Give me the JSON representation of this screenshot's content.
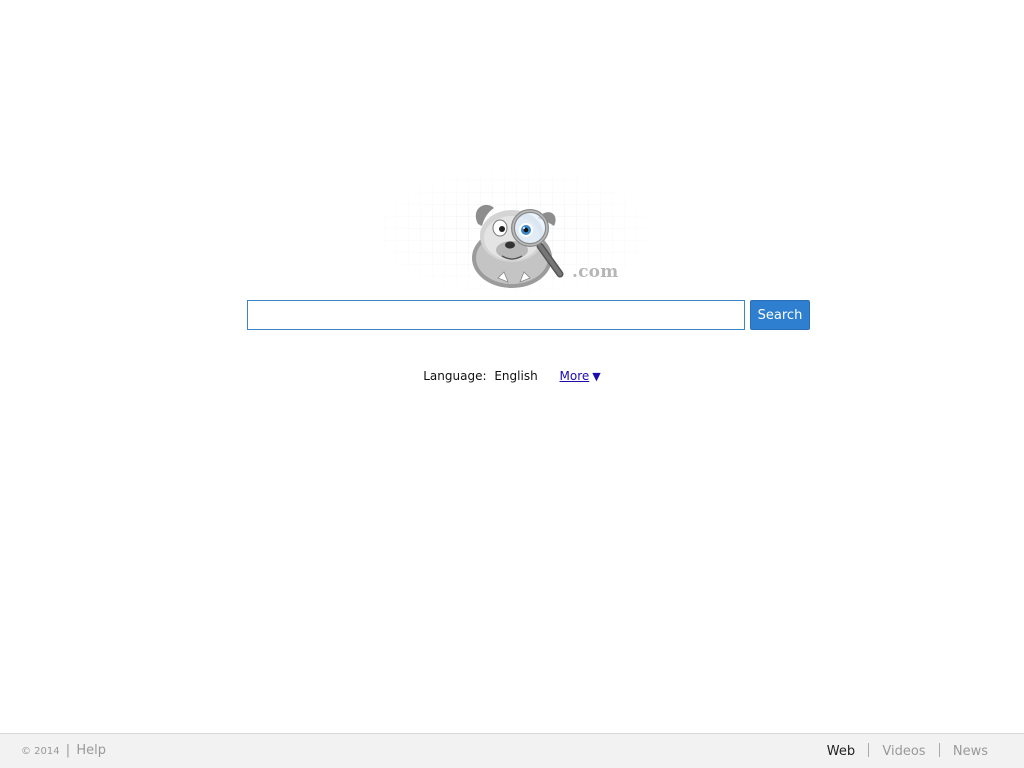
{
  "logo": {
    "suffix": ".com",
    "icon": "bulldog-magnifier-icon"
  },
  "search": {
    "value": "",
    "placeholder": "",
    "button_label": "Search"
  },
  "language": {
    "label": "Language:",
    "value": "English",
    "more_label": "More",
    "more_arrow": "▼"
  },
  "footer": {
    "copyright": "© 2014",
    "separator": "|",
    "help_label": "Help",
    "nav": [
      {
        "label": "Web",
        "active": true
      },
      {
        "label": "Videos",
        "active": false
      },
      {
        "label": "News",
        "active": false
      }
    ]
  },
  "colors": {
    "accent": "#2e7fcf",
    "input_border": "#3f83c4",
    "link": "#1a0dab",
    "footer_bg": "#f2f2f2"
  }
}
